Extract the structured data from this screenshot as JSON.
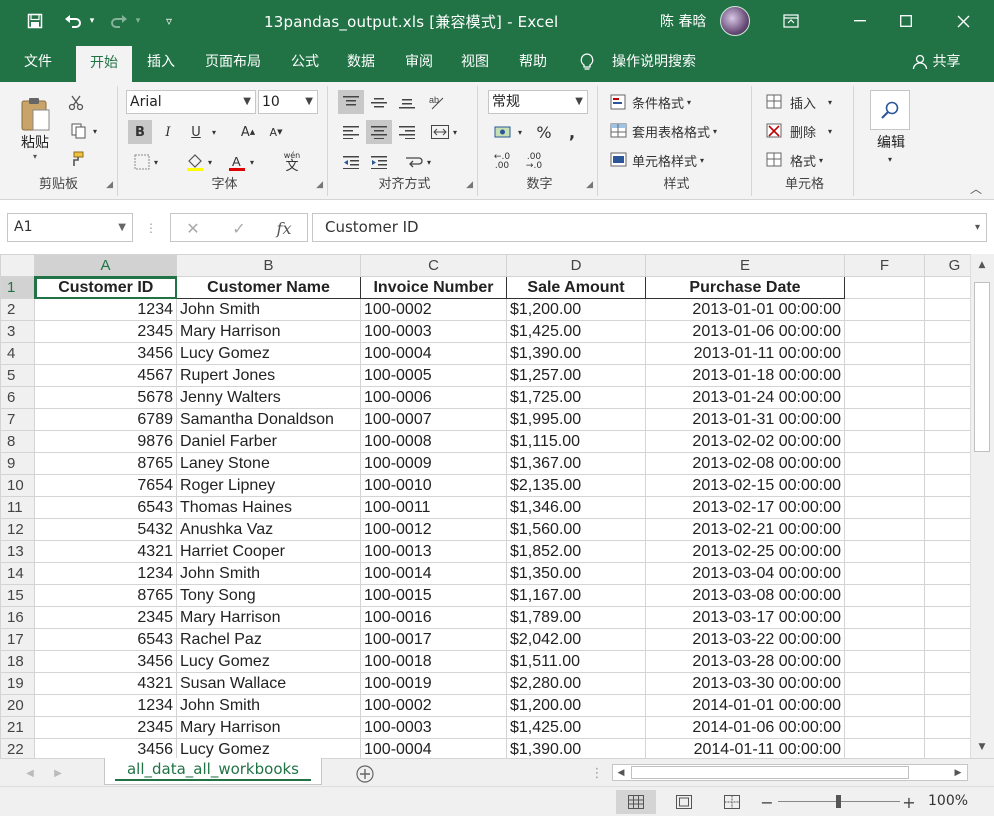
{
  "window": {
    "title": "13pandas_output.xls  [兼容模式]  -  Excel",
    "user": "陈 春晗"
  },
  "tabs": [
    "文件",
    "开始",
    "插入",
    "页面布局",
    "公式",
    "数据",
    "审阅",
    "视图",
    "帮助"
  ],
  "active_tab": "开始",
  "tell_me": "操作说明搜索",
  "share": "共享",
  "ribbon": {
    "clipboard": {
      "label": "剪贴板",
      "paste": "粘贴"
    },
    "font": {
      "label": "字体",
      "name": "Arial",
      "size": "10",
      "bold": "B",
      "italic": "I",
      "underline": "U",
      "wen": "wén"
    },
    "alignment": {
      "label": "对齐方式"
    },
    "number": {
      "label": "数字",
      "format": "常规"
    },
    "styles": {
      "label": "样式",
      "conditional": "条件格式",
      "table": "套用表格格式",
      "cell": "单元格样式"
    },
    "cells": {
      "label": "单元格",
      "insert": "插入",
      "delete": "删除",
      "format": "格式"
    },
    "editing": {
      "label": "编辑"
    }
  },
  "formula_bar": {
    "name_box": "A1",
    "content": "Customer ID",
    "fx": "fx"
  },
  "sheet": {
    "columns": [
      "A",
      "B",
      "C",
      "D",
      "E",
      "F",
      "G"
    ],
    "headers": [
      "Customer ID",
      "Customer Name",
      "Invoice Number",
      "Sale Amount",
      "Purchase Date"
    ],
    "rows": [
      [
        "1234",
        "John Smith",
        "100-0002",
        "$1,200.00",
        "2013-01-01 00:00:00"
      ],
      [
        "2345",
        "Mary Harrison",
        "100-0003",
        "$1,425.00",
        "2013-01-06 00:00:00"
      ],
      [
        "3456",
        "Lucy Gomez",
        "100-0004",
        "$1,390.00",
        "2013-01-11 00:00:00"
      ],
      [
        "4567",
        "Rupert Jones",
        "100-0005",
        "$1,257.00",
        "2013-01-18 00:00:00"
      ],
      [
        "5678",
        "Jenny Walters",
        "100-0006",
        "$1,725.00",
        "2013-01-24 00:00:00"
      ],
      [
        "6789",
        "Samantha Donaldson",
        "100-0007",
        "$1,995.00",
        "2013-01-31 00:00:00"
      ],
      [
        "9876",
        "Daniel Farber",
        "100-0008",
        "$1,115.00",
        "2013-02-02 00:00:00"
      ],
      [
        "8765",
        "Laney Stone",
        "100-0009",
        "$1,367.00",
        "2013-02-08 00:00:00"
      ],
      [
        "7654",
        "Roger Lipney",
        "100-0010",
        "$2,135.00",
        "2013-02-15 00:00:00"
      ],
      [
        "6543",
        "Thomas Haines",
        "100-0011",
        "$1,346.00",
        "2013-02-17 00:00:00"
      ],
      [
        "5432",
        "Anushka Vaz",
        "100-0012",
        "$1,560.00",
        "2013-02-21 00:00:00"
      ],
      [
        "4321",
        "Harriet Cooper",
        "100-0013",
        "$1,852.00",
        "2013-02-25 00:00:00"
      ],
      [
        "1234",
        "John Smith",
        "100-0014",
        "$1,350.00",
        "2013-03-04 00:00:00"
      ],
      [
        "8765",
        "Tony Song",
        "100-0015",
        "$1,167.00",
        "2013-03-08 00:00:00"
      ],
      [
        "2345",
        "Mary Harrison",
        "100-0016",
        "$1,789.00",
        "2013-03-17 00:00:00"
      ],
      [
        "6543",
        "Rachel Paz",
        "100-0017",
        "$2,042.00",
        "2013-03-22 00:00:00"
      ],
      [
        "3456",
        "Lucy Gomez",
        "100-0018",
        "$1,511.00",
        "2013-03-28 00:00:00"
      ],
      [
        "4321",
        "Susan Wallace",
        "100-0019",
        "$2,280.00",
        "2013-03-30 00:00:00"
      ],
      [
        "1234",
        "John Smith",
        "100-0002",
        "$1,200.00",
        "2014-01-01 00:00:00"
      ],
      [
        "2345",
        "Mary Harrison",
        "100-0003",
        "$1,425.00",
        "2014-01-06 00:00:00"
      ],
      [
        "3456",
        "Lucy Gomez",
        "100-0004",
        "$1,390.00",
        "2014-01-11 00:00:00"
      ]
    ]
  },
  "sheet_tab": "all_data_all_workbooks",
  "status": {
    "zoom": "100%"
  },
  "colors": {
    "accent": "#217346",
    "ribbon_bg": "#f3f3f3",
    "grid": "#d4d4d4"
  }
}
